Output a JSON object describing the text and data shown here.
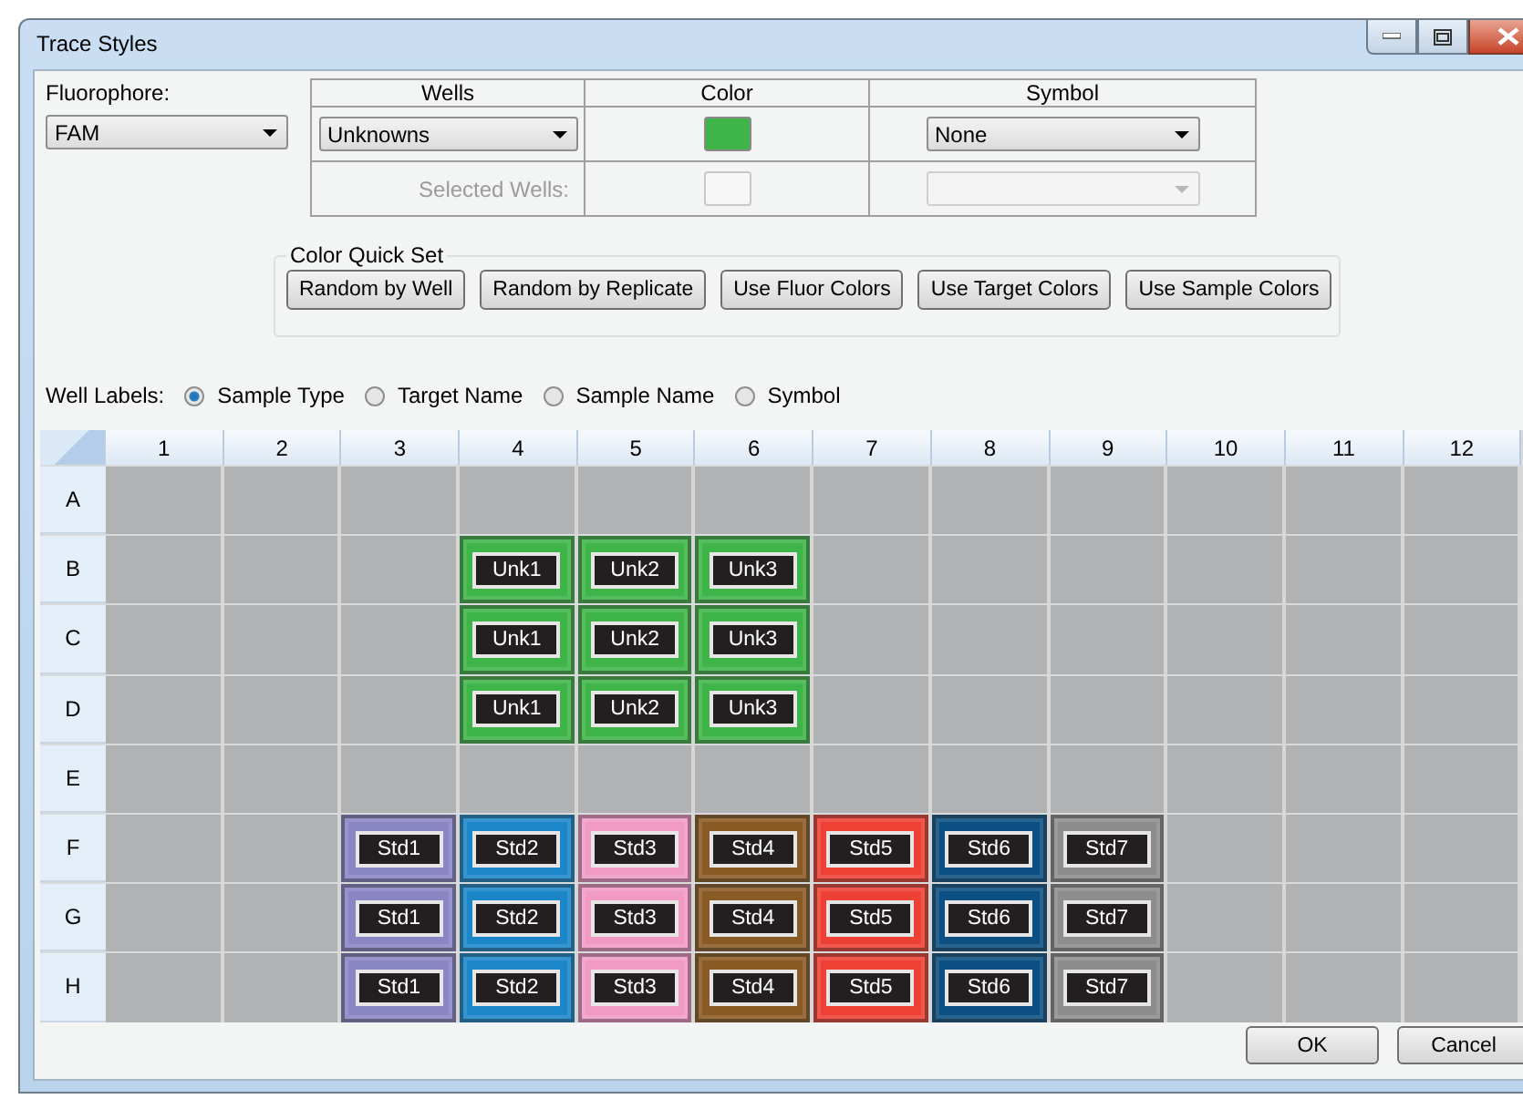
{
  "window": {
    "title": "Trace Styles"
  },
  "fluorophore": {
    "label": "Fluorophore:",
    "value": "FAM"
  },
  "style_table": {
    "columns": [
      "Wells",
      "Color",
      "Symbol"
    ],
    "rows": [
      {
        "wells": "Unknowns",
        "color": "#3fb449",
        "symbol": "None",
        "disabled": false
      },
      {
        "wells_label": "Selected Wells:",
        "disabled": true
      }
    ]
  },
  "color_quick_set": {
    "title": "Color Quick Set",
    "buttons": [
      "Random by Well",
      "Random by Replicate",
      "Use Fluor Colors",
      "Use Target Colors",
      "Use Sample Colors"
    ]
  },
  "well_labels": {
    "label": "Well Labels:",
    "options": [
      {
        "label": "Sample Type",
        "selected": true
      },
      {
        "label": "Target Name",
        "selected": false
      },
      {
        "label": "Sample Name",
        "selected": false
      },
      {
        "label": "Symbol",
        "selected": false
      }
    ]
  },
  "plate": {
    "columns": [
      "1",
      "2",
      "3",
      "4",
      "5",
      "6",
      "7",
      "8",
      "9",
      "10",
      "11",
      "12"
    ],
    "rows": [
      {
        "label": "A",
        "wells": [
          {
            "kind": "empty"
          },
          {
            "kind": "empty"
          },
          {
            "kind": "empty"
          },
          {
            "kind": "empty"
          },
          {
            "kind": "empty"
          },
          {
            "kind": "empty"
          },
          {
            "kind": "empty"
          },
          {
            "kind": "empty"
          },
          {
            "kind": "empty"
          },
          {
            "kind": "empty"
          },
          {
            "kind": "empty"
          },
          {
            "kind": "empty"
          }
        ]
      },
      {
        "label": "B",
        "wells": [
          {
            "kind": "empty"
          },
          {
            "kind": "empty"
          },
          {
            "kind": "empty"
          },
          {
            "kind": "sample",
            "label": "Unk1",
            "color": "#3fb449"
          },
          {
            "kind": "sample",
            "label": "Unk2",
            "color": "#3fb449"
          },
          {
            "kind": "sample",
            "label": "Unk3",
            "color": "#3fb449"
          },
          {
            "kind": "empty"
          },
          {
            "kind": "empty"
          },
          {
            "kind": "empty"
          },
          {
            "kind": "empty"
          },
          {
            "kind": "empty"
          },
          {
            "kind": "empty"
          }
        ]
      },
      {
        "label": "C",
        "wells": [
          {
            "kind": "empty"
          },
          {
            "kind": "empty"
          },
          {
            "kind": "empty"
          },
          {
            "kind": "sample",
            "label": "Unk1",
            "color": "#3fb449"
          },
          {
            "kind": "sample",
            "label": "Unk2",
            "color": "#3fb449"
          },
          {
            "kind": "sample",
            "label": "Unk3",
            "color": "#3fb449"
          },
          {
            "kind": "empty"
          },
          {
            "kind": "empty"
          },
          {
            "kind": "empty"
          },
          {
            "kind": "empty"
          },
          {
            "kind": "empty"
          },
          {
            "kind": "empty"
          }
        ]
      },
      {
        "label": "D",
        "wells": [
          {
            "kind": "empty"
          },
          {
            "kind": "empty"
          },
          {
            "kind": "empty"
          },
          {
            "kind": "sample",
            "label": "Unk1",
            "color": "#3fb449"
          },
          {
            "kind": "sample",
            "label": "Unk2",
            "color": "#3fb449"
          },
          {
            "kind": "sample",
            "label": "Unk3",
            "color": "#3fb449"
          },
          {
            "kind": "empty"
          },
          {
            "kind": "empty"
          },
          {
            "kind": "empty"
          },
          {
            "kind": "empty"
          },
          {
            "kind": "empty"
          },
          {
            "kind": "empty"
          }
        ]
      },
      {
        "label": "E",
        "wells": [
          {
            "kind": "empty"
          },
          {
            "kind": "empty"
          },
          {
            "kind": "empty"
          },
          {
            "kind": "empty"
          },
          {
            "kind": "empty"
          },
          {
            "kind": "empty"
          },
          {
            "kind": "empty"
          },
          {
            "kind": "empty"
          },
          {
            "kind": "empty"
          },
          {
            "kind": "empty"
          },
          {
            "kind": "empty"
          },
          {
            "kind": "empty"
          }
        ]
      },
      {
        "label": "F",
        "wells": [
          {
            "kind": "empty"
          },
          {
            "kind": "empty"
          },
          {
            "kind": "sample",
            "label": "Std1",
            "color": "#8a86c4"
          },
          {
            "kind": "sample",
            "label": "Std2",
            "color": "#1b86c8"
          },
          {
            "kind": "sample",
            "label": "Std3",
            "color": "#f09ac4"
          },
          {
            "kind": "sample",
            "label": "Std4",
            "color": "#8a5a25"
          },
          {
            "kind": "sample",
            "label": "Std5",
            "color": "#ee4035"
          },
          {
            "kind": "sample",
            "label": "Std6",
            "color": "#0c4f82"
          },
          {
            "kind": "sample",
            "label": "Std7",
            "color": "#8d8d8d"
          },
          {
            "kind": "empty"
          },
          {
            "kind": "empty"
          },
          {
            "kind": "empty"
          }
        ]
      },
      {
        "label": "G",
        "wells": [
          {
            "kind": "empty"
          },
          {
            "kind": "empty"
          },
          {
            "kind": "sample",
            "label": "Std1",
            "color": "#8a86c4"
          },
          {
            "kind": "sample",
            "label": "Std2",
            "color": "#1b86c8"
          },
          {
            "kind": "sample",
            "label": "Std3",
            "color": "#f09ac4"
          },
          {
            "kind": "sample",
            "label": "Std4",
            "color": "#8a5a25"
          },
          {
            "kind": "sample",
            "label": "Std5",
            "color": "#ee4035"
          },
          {
            "kind": "sample",
            "label": "Std6",
            "color": "#0c4f82"
          },
          {
            "kind": "sample",
            "label": "Std7",
            "color": "#8d8d8d"
          },
          {
            "kind": "empty"
          },
          {
            "kind": "empty"
          },
          {
            "kind": "empty"
          }
        ]
      },
      {
        "label": "H",
        "wells": [
          {
            "kind": "empty"
          },
          {
            "kind": "empty"
          },
          {
            "kind": "sample",
            "label": "Std1",
            "color": "#8a86c4"
          },
          {
            "kind": "sample",
            "label": "Std2",
            "color": "#1b86c8"
          },
          {
            "kind": "sample",
            "label": "Std3",
            "color": "#f09ac4"
          },
          {
            "kind": "sample",
            "label": "Std4",
            "color": "#8a5a25"
          },
          {
            "kind": "sample",
            "label": "Std5",
            "color": "#ee4035"
          },
          {
            "kind": "sample",
            "label": "Std6",
            "color": "#0c4f82"
          },
          {
            "kind": "sample",
            "label": "Std7",
            "color": "#8d8d8d"
          },
          {
            "kind": "empty"
          },
          {
            "kind": "empty"
          },
          {
            "kind": "empty"
          }
        ]
      }
    ]
  },
  "buttons": [
    "OK",
    "Cancel"
  ]
}
